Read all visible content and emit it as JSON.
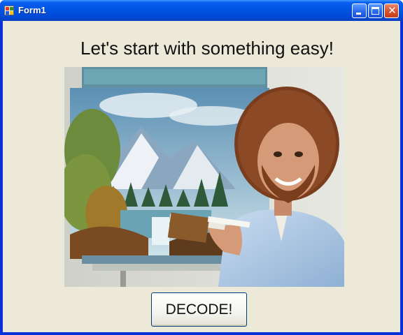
{
  "window": {
    "title": "Form1",
    "controls": [
      "minimize",
      "maximize",
      "close"
    ],
    "title_icon": "form-app-icon"
  },
  "main": {
    "heading": "Let's start with something easy!",
    "picture": {
      "description": "Bob Ross painting",
      "scene": "snowy mountains, waterfall, pine trees, painter with afro holding brush"
    },
    "decode_button": "DECODE!"
  },
  "colors": {
    "titlebar": "#0054e3",
    "client_bg": "#ece9d8",
    "close_button": "#d8502a",
    "button_border": "#003c74"
  }
}
